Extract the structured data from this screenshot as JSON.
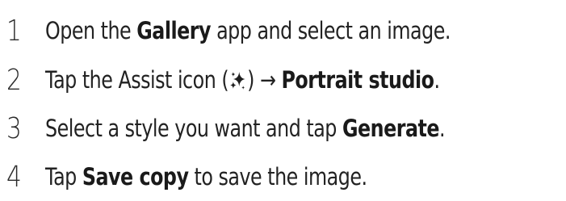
{
  "steps": [
    {
      "number": "1",
      "t1": "Open the ",
      "b1": "Gallery",
      "t2": " app and select an image."
    },
    {
      "number": "2",
      "t1": "Tap the Assist icon (",
      "icon": "assist-sparkle-icon",
      "t2": ") → ",
      "b1": "Portrait studio",
      "t3": "."
    },
    {
      "number": "3",
      "t1": "Select a style you want and tap ",
      "b1": "Generate",
      "t2": "."
    },
    {
      "number": "4",
      "t1": "Tap ",
      "b1": "Save copy",
      "t2": " to save the image."
    }
  ]
}
